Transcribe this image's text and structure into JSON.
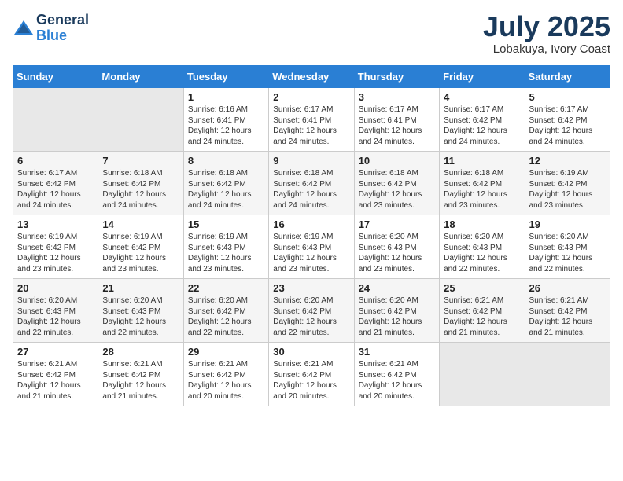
{
  "logo": {
    "general": "General",
    "blue": "Blue"
  },
  "title": "July 2025",
  "location": "Lobakuya, Ivory Coast",
  "days_of_week": [
    "Sunday",
    "Monday",
    "Tuesday",
    "Wednesday",
    "Thursday",
    "Friday",
    "Saturday"
  ],
  "weeks": [
    [
      {
        "day": "",
        "sunrise": "",
        "sunset": "",
        "daylight": ""
      },
      {
        "day": "",
        "sunrise": "",
        "sunset": "",
        "daylight": ""
      },
      {
        "day": "1",
        "sunrise": "Sunrise: 6:16 AM",
        "sunset": "Sunset: 6:41 PM",
        "daylight": "Daylight: 12 hours and 24 minutes."
      },
      {
        "day": "2",
        "sunrise": "Sunrise: 6:17 AM",
        "sunset": "Sunset: 6:41 PM",
        "daylight": "Daylight: 12 hours and 24 minutes."
      },
      {
        "day": "3",
        "sunrise": "Sunrise: 6:17 AM",
        "sunset": "Sunset: 6:41 PM",
        "daylight": "Daylight: 12 hours and 24 minutes."
      },
      {
        "day": "4",
        "sunrise": "Sunrise: 6:17 AM",
        "sunset": "Sunset: 6:42 PM",
        "daylight": "Daylight: 12 hours and 24 minutes."
      },
      {
        "day": "5",
        "sunrise": "Sunrise: 6:17 AM",
        "sunset": "Sunset: 6:42 PM",
        "daylight": "Daylight: 12 hours and 24 minutes."
      }
    ],
    [
      {
        "day": "6",
        "sunrise": "Sunrise: 6:17 AM",
        "sunset": "Sunset: 6:42 PM",
        "daylight": "Daylight: 12 hours and 24 minutes."
      },
      {
        "day": "7",
        "sunrise": "Sunrise: 6:18 AM",
        "sunset": "Sunset: 6:42 PM",
        "daylight": "Daylight: 12 hours and 24 minutes."
      },
      {
        "day": "8",
        "sunrise": "Sunrise: 6:18 AM",
        "sunset": "Sunset: 6:42 PM",
        "daylight": "Daylight: 12 hours and 24 minutes."
      },
      {
        "day": "9",
        "sunrise": "Sunrise: 6:18 AM",
        "sunset": "Sunset: 6:42 PM",
        "daylight": "Daylight: 12 hours and 24 minutes."
      },
      {
        "day": "10",
        "sunrise": "Sunrise: 6:18 AM",
        "sunset": "Sunset: 6:42 PM",
        "daylight": "Daylight: 12 hours and 23 minutes."
      },
      {
        "day": "11",
        "sunrise": "Sunrise: 6:18 AM",
        "sunset": "Sunset: 6:42 PM",
        "daylight": "Daylight: 12 hours and 23 minutes."
      },
      {
        "day": "12",
        "sunrise": "Sunrise: 6:19 AM",
        "sunset": "Sunset: 6:42 PM",
        "daylight": "Daylight: 12 hours and 23 minutes."
      }
    ],
    [
      {
        "day": "13",
        "sunrise": "Sunrise: 6:19 AM",
        "sunset": "Sunset: 6:42 PM",
        "daylight": "Daylight: 12 hours and 23 minutes."
      },
      {
        "day": "14",
        "sunrise": "Sunrise: 6:19 AM",
        "sunset": "Sunset: 6:42 PM",
        "daylight": "Daylight: 12 hours and 23 minutes."
      },
      {
        "day": "15",
        "sunrise": "Sunrise: 6:19 AM",
        "sunset": "Sunset: 6:43 PM",
        "daylight": "Daylight: 12 hours and 23 minutes."
      },
      {
        "day": "16",
        "sunrise": "Sunrise: 6:19 AM",
        "sunset": "Sunset: 6:43 PM",
        "daylight": "Daylight: 12 hours and 23 minutes."
      },
      {
        "day": "17",
        "sunrise": "Sunrise: 6:20 AM",
        "sunset": "Sunset: 6:43 PM",
        "daylight": "Daylight: 12 hours and 23 minutes."
      },
      {
        "day": "18",
        "sunrise": "Sunrise: 6:20 AM",
        "sunset": "Sunset: 6:43 PM",
        "daylight": "Daylight: 12 hours and 22 minutes."
      },
      {
        "day": "19",
        "sunrise": "Sunrise: 6:20 AM",
        "sunset": "Sunset: 6:43 PM",
        "daylight": "Daylight: 12 hours and 22 minutes."
      }
    ],
    [
      {
        "day": "20",
        "sunrise": "Sunrise: 6:20 AM",
        "sunset": "Sunset: 6:43 PM",
        "daylight": "Daylight: 12 hours and 22 minutes."
      },
      {
        "day": "21",
        "sunrise": "Sunrise: 6:20 AM",
        "sunset": "Sunset: 6:43 PM",
        "daylight": "Daylight: 12 hours and 22 minutes."
      },
      {
        "day": "22",
        "sunrise": "Sunrise: 6:20 AM",
        "sunset": "Sunset: 6:42 PM",
        "daylight": "Daylight: 12 hours and 22 minutes."
      },
      {
        "day": "23",
        "sunrise": "Sunrise: 6:20 AM",
        "sunset": "Sunset: 6:42 PM",
        "daylight": "Daylight: 12 hours and 22 minutes."
      },
      {
        "day": "24",
        "sunrise": "Sunrise: 6:20 AM",
        "sunset": "Sunset: 6:42 PM",
        "daylight": "Daylight: 12 hours and 21 minutes."
      },
      {
        "day": "25",
        "sunrise": "Sunrise: 6:21 AM",
        "sunset": "Sunset: 6:42 PM",
        "daylight": "Daylight: 12 hours and 21 minutes."
      },
      {
        "day": "26",
        "sunrise": "Sunrise: 6:21 AM",
        "sunset": "Sunset: 6:42 PM",
        "daylight": "Daylight: 12 hours and 21 minutes."
      }
    ],
    [
      {
        "day": "27",
        "sunrise": "Sunrise: 6:21 AM",
        "sunset": "Sunset: 6:42 PM",
        "daylight": "Daylight: 12 hours and 21 minutes."
      },
      {
        "day": "28",
        "sunrise": "Sunrise: 6:21 AM",
        "sunset": "Sunset: 6:42 PM",
        "daylight": "Daylight: 12 hours and 21 minutes."
      },
      {
        "day": "29",
        "sunrise": "Sunrise: 6:21 AM",
        "sunset": "Sunset: 6:42 PM",
        "daylight": "Daylight: 12 hours and 20 minutes."
      },
      {
        "day": "30",
        "sunrise": "Sunrise: 6:21 AM",
        "sunset": "Sunset: 6:42 PM",
        "daylight": "Daylight: 12 hours and 20 minutes."
      },
      {
        "day": "31",
        "sunrise": "Sunrise: 6:21 AM",
        "sunset": "Sunset: 6:42 PM",
        "daylight": "Daylight: 12 hours and 20 minutes."
      },
      {
        "day": "",
        "sunrise": "",
        "sunset": "",
        "daylight": ""
      },
      {
        "day": "",
        "sunrise": "",
        "sunset": "",
        "daylight": ""
      }
    ]
  ]
}
